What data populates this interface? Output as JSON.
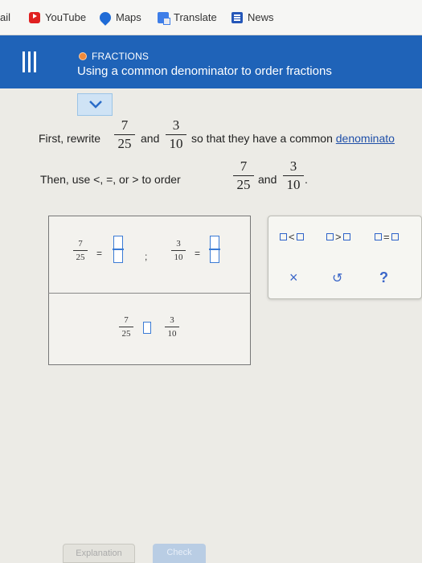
{
  "bookmarks": {
    "items": [
      {
        "label": "ail"
      },
      {
        "label": "YouTube",
        "icon": "youtube-icon"
      },
      {
        "label": "Maps",
        "icon": "maps-icon"
      },
      {
        "label": "Translate",
        "icon": "translate-icon"
      },
      {
        "label": "News",
        "icon": "news-icon"
      }
    ]
  },
  "header": {
    "topic": "FRACTIONS",
    "title": "Using a common denominator to order fractions",
    "bg_color": "#1f63b8",
    "topic_dot_color": "#f08a3a"
  },
  "question": {
    "line1_prefix": "First, rewrite",
    "line1_and": "and",
    "line1_suffix": "so that they have a common",
    "line1_link": "denominato",
    "line2_prefix": "Then, use <, =, or > to order",
    "line2_and": "and",
    "line2_end": ".",
    "frac1": {
      "num": "7",
      "den": "25"
    },
    "frac2": {
      "num": "3",
      "den": "10"
    }
  },
  "answer": {
    "row1_eq": "=",
    "row1_sep": ";",
    "row1_eq2": "="
  },
  "palette": {
    "less_than": "<",
    "greater_than": ">",
    "equals": "=",
    "clear": "×",
    "undo": "↺",
    "help": "?"
  },
  "footer": {
    "explanation_label": "Explanation",
    "check_label": "Check"
  }
}
